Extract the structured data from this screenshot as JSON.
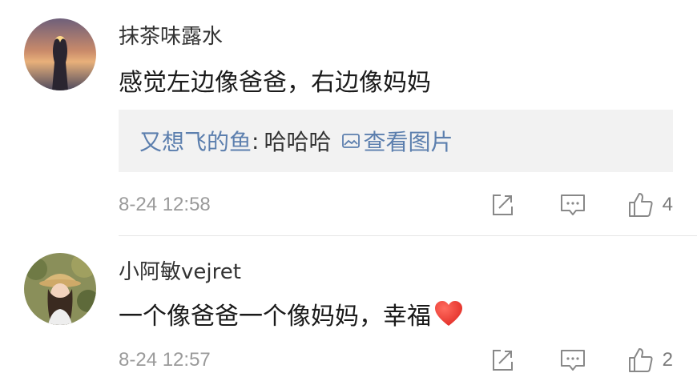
{
  "comments": [
    {
      "username": "抹茶味露水",
      "text": "感觉左边像爸爸，右边像妈妈",
      "reply": {
        "author": "又想飞的鱼",
        "colon": ":",
        "text": "哈哈哈",
        "view_picture": "查看图片"
      },
      "time": "8-24 12:58",
      "likes": "4"
    },
    {
      "username": "小阿敏vejret",
      "text": "一个像爸爸一个像妈妈，幸福",
      "emoji": "red-heart-icon",
      "time": "8-24 12:57",
      "likes": "2"
    }
  ],
  "colors": {
    "link": "#5c7fae",
    "meta": "#9a9a9a",
    "reply_bg": "#f2f2f2",
    "heart": "#e8332f"
  },
  "icons": [
    "share-icon",
    "comment-icon",
    "thumbs-up-icon",
    "image-icon"
  ]
}
